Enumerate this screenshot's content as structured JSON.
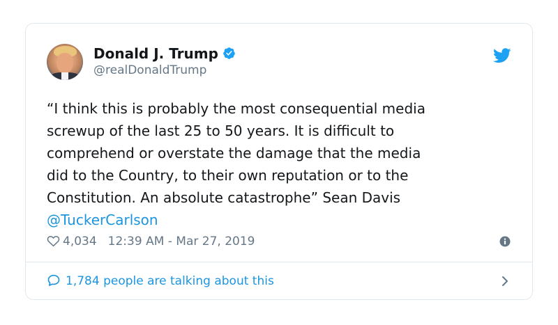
{
  "tweet": {
    "author": {
      "display_name": "Donald J. Trump",
      "handle": "@realDonaldTrump",
      "verified": true,
      "avatar_icon": "profile-photo"
    },
    "text": "“I think this is probably the most consequential media\nscrewup of the last 25 to 50 years. It is difficult to\ncomprehend or overstate the damage that the media\ndid to the Country, to their own reputation or to the\nConstitution. An absolute catastrophe” Sean Davis",
    "mention": "@TuckerCarlson",
    "likes": "4,034",
    "timestamp": "12:39 AM - Mar 27, 2019",
    "footer_text": "1,784 people are talking about this",
    "icons": {
      "brand": "twitter-bird-icon",
      "verified": "verified-badge-icon",
      "like": "heart-icon",
      "info": "info-icon",
      "reply": "speech-bubble-icon",
      "navigate": "chevron-right-icon"
    },
    "colors": {
      "brand_blue": "#1da1f2",
      "link_blue": "#1b95e0",
      "text": "#14171a",
      "muted": "#657786",
      "border": "#e1e8ed"
    }
  }
}
